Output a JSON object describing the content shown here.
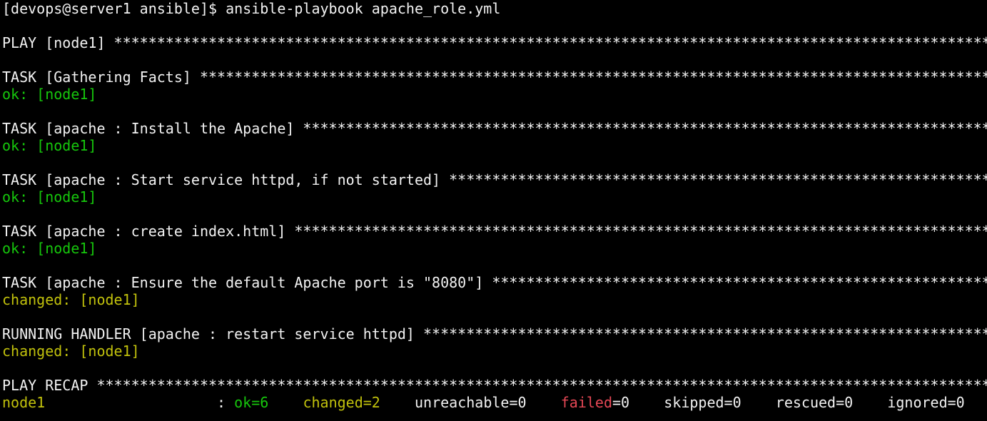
{
  "terminal": {
    "prompt": "[devops@server1 ansible]$ ansible-playbook apache_role.yml",
    "play_header": "PLAY [node1] ******************************************************************************************************",
    "tasks": [
      {
        "header": "TASK [Gathering Facts] ********************************************************************************************",
        "result": "ok: [node1]",
        "status": "ok"
      },
      {
        "header": "TASK [apache : Install the Apache] ********************************************************************************",
        "result": "ok: [node1]",
        "status": "ok"
      },
      {
        "header": "TASK [apache : Start service httpd, if not started] ***************************************************************",
        "result": "ok: [node1]",
        "status": "ok"
      },
      {
        "header": "TASK [apache : create index.html] *********************************************************************************",
        "result": "ok: [node1]",
        "status": "ok"
      },
      {
        "header": "TASK [apache : Ensure the default Apache port is \"8080\"] **********************************************************",
        "result": "changed: [node1]",
        "status": "changed"
      },
      {
        "header": "RUNNING HANDLER [apache : restart service httpd] ******************************************************************",
        "result": "changed: [node1]",
        "status": "changed"
      }
    ],
    "recap_header": "PLAY RECAP ********************************************************************************************************",
    "recap": {
      "host": "node1",
      "separator": "                    : ",
      "ok": "ok=6",
      "gap1": "    ",
      "changed": "changed=2",
      "gap2": "    ",
      "unreachable": "unreachable=0",
      "gap3": "    ",
      "failed_label": "failed",
      "failed_value": "=0",
      "gap4": "    ",
      "skipped": "skipped=0",
      "gap5": "    ",
      "rescued": "rescued=0",
      "gap6": "    ",
      "ignored": "ignored=0"
    }
  }
}
